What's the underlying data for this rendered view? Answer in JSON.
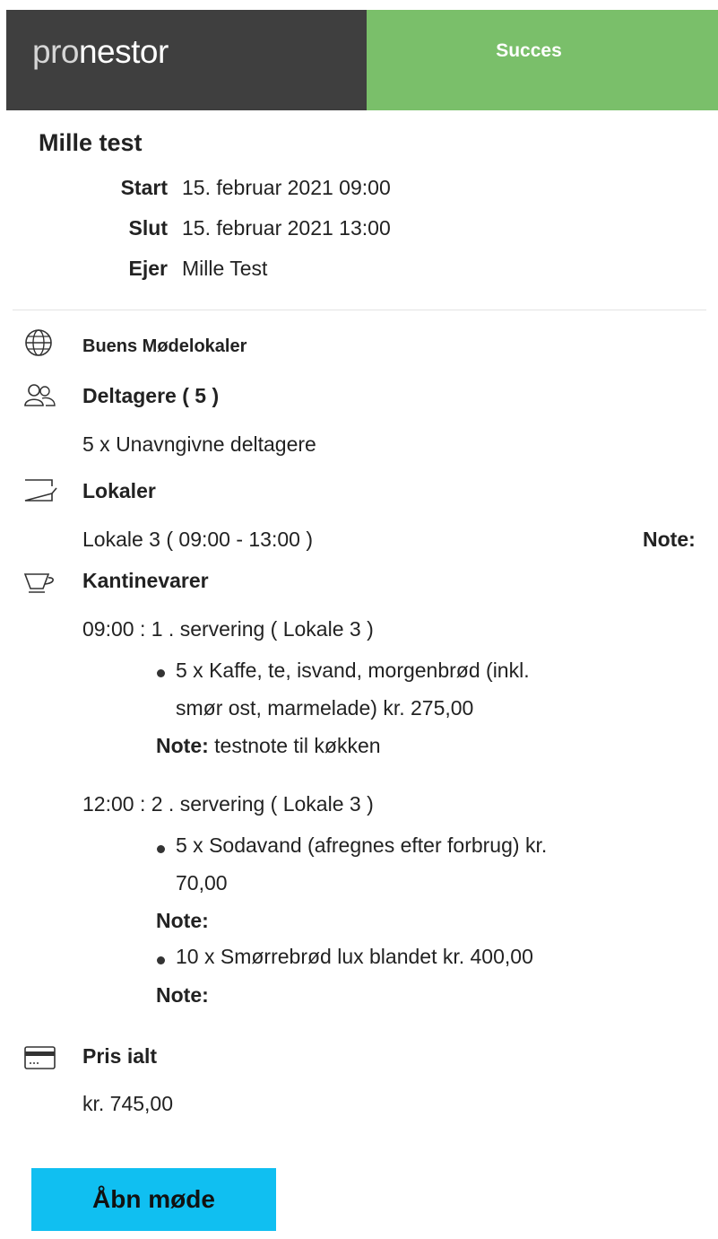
{
  "header": {
    "logo_pro": "pro",
    "logo_nestor": "nestor",
    "status": "Succes"
  },
  "booking": {
    "title": "Mille test",
    "start_label": "Start",
    "start_value": "15. februar 2021 09:00",
    "end_label": "Slut",
    "end_value": "15. februar 2021 13:00",
    "owner_label": "Ejer",
    "owner_value": "Mille Test"
  },
  "location": {
    "icon": "globe-icon",
    "name": "Buens Mødelokaler"
  },
  "participants": {
    "icon": "people-icon",
    "heading": "Deltagere ( 5 )",
    "line": "5 x Unavngivne deltagere"
  },
  "rooms": {
    "icon": "room-icon",
    "heading": "Lokaler",
    "room": "Lokale 3 ( 09:00 - 13:00 )",
    "note_label": "Note:"
  },
  "catering": {
    "icon": "cup-icon",
    "heading": "Kantinevarer",
    "servings": [
      {
        "title": "09:00 : 1 . servering ( Lokale 3 )",
        "item_line1": "5 x Kaffe, te, isvand, morgenbrød (inkl.",
        "item_line2": "smør ost, marmelade) kr. 275,00",
        "note_label": "Note:",
        "note_text": "testnote til køkken"
      },
      {
        "title": "12:00 : 2 . servering ( Lokale 3 )",
        "item1_line1": "5 x Sodavand (afregnes efter forbrug) kr.",
        "item1_line2": "70,00",
        "item1_note": "Note:",
        "item2_line1": "10 x Smørrebrød lux blandet kr. 400,00",
        "item2_note": "Note:"
      }
    ]
  },
  "price": {
    "icon": "credit-card-icon",
    "heading": "Pris ialt",
    "value": "kr. 745,00"
  },
  "actions": {
    "open_meeting": "Åbn møde"
  }
}
